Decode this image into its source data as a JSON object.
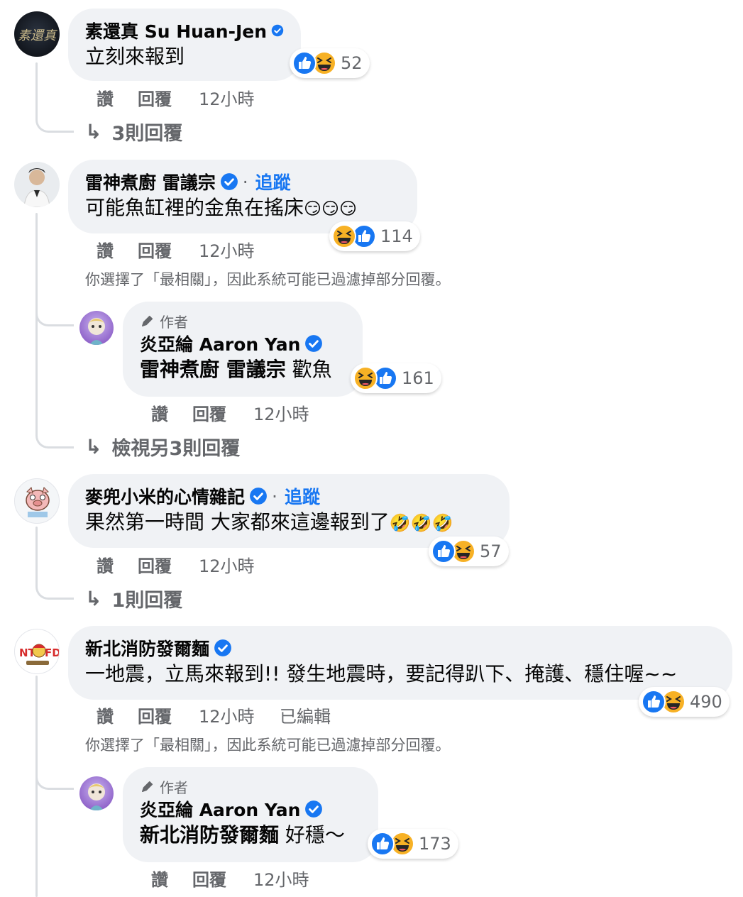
{
  "comments": [
    {
      "author": "素還真 Su Huan-Jen",
      "text": "立刻來報到",
      "reaction_count": "52",
      "reactions": [
        "like",
        "haha"
      ],
      "actions": {
        "like": "讚",
        "reply": "回覆",
        "time": "12小時"
      },
      "replies_link": "3則回覆"
    },
    {
      "author": "雷神煮廚 雷議宗",
      "follow": "追蹤",
      "text": "可能魚缸裡的金魚在搖床",
      "emoji": "😏😏😏",
      "reaction_count": "114",
      "reactions": [
        "haha",
        "like"
      ],
      "actions": {
        "like": "讚",
        "reply": "回覆",
        "time": "12小時"
      },
      "filter_note": "你選擇了「最相關」，因此系統可能已過濾掉部分回覆。",
      "reply": {
        "author_label": "作者",
        "author": "炎亞綸 Aaron Yan",
        "mention": "雷神煮廚 雷議宗",
        "text": "歡魚",
        "reaction_count": "161",
        "reactions": [
          "haha",
          "like"
        ],
        "actions": {
          "like": "讚",
          "reply": "回覆",
          "time": "12小時"
        }
      },
      "replies_link": "檢視另3則回覆"
    },
    {
      "author": "麥兜小米的心情雜記",
      "follow": "追蹤",
      "text": "果然第一時間 大家都來這邊報到了",
      "emoji": "🤣🤣🤣",
      "reaction_count": "57",
      "reactions": [
        "like",
        "haha"
      ],
      "actions": {
        "like": "讚",
        "reply": "回覆",
        "time": "12小時"
      },
      "replies_link": "1則回覆"
    },
    {
      "author": "新北消防發爾麵",
      "text": "一地震，立馬來報到!! 發生地震時，要記得趴下、掩護、穩住喔~~",
      "reaction_count": "490",
      "reactions": [
        "like",
        "haha"
      ],
      "actions": {
        "like": "讚",
        "reply": "回覆",
        "time": "12小時",
        "edited": "已編輯"
      },
      "filter_note": "你選擇了「最相關」，因此系統可能已過濾掉部分回覆。",
      "reply": {
        "author_label": "作者",
        "author": "炎亞綸 Aaron Yan",
        "mention": "新北消防發爾麵",
        "text": "好穩～",
        "reaction_count": "173",
        "reactions": [
          "like",
          "haha"
        ],
        "actions": {
          "like": "讚",
          "reply": "回覆",
          "time": "12小時"
        }
      }
    }
  ],
  "colors": {
    "bubble": "#f0f2f5",
    "verified": "#1877f2",
    "link": "#1877f2",
    "muted": "#65676b",
    "thread_line": "#dadde1",
    "like": "#1877f2",
    "haha": "#f7b125"
  },
  "icons": {
    "verified": "verified-badge-icon",
    "like": "like-reaction-icon",
    "haha": "haha-reaction-icon",
    "reply_arrow": "reply-arrow-icon",
    "author": "pen-author-icon"
  }
}
